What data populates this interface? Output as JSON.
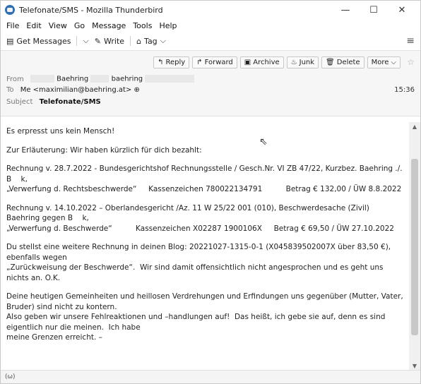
{
  "window": {
    "title": "Telefonate/SMS - Mozilla Thunderbird",
    "minimize": "—",
    "maximize": "☐",
    "close": "✕"
  },
  "menu": [
    "File",
    "Edit",
    "View",
    "Go",
    "Message",
    "Tools",
    "Help"
  ],
  "toolbar": {
    "get_messages": "Get Messages",
    "write": "Write",
    "tag": "Tag"
  },
  "actions": {
    "reply": "Reply",
    "forward": "Forward",
    "archive": "Archive",
    "junk": "Junk",
    "delete": "Delete",
    "more": "More"
  },
  "header": {
    "from_label": "From",
    "from_name": "Baehring",
    "from_email_part": "baehring",
    "to_label": "To",
    "to_value": "Me <maximilian@baehring.at>",
    "subject_label": "Subject",
    "subject": "Telefonate/SMS",
    "time": "15:36"
  },
  "body": [
    "Es erpresst uns kein Mensch!",
    "Zur Erläuterung: Wir haben kürzlich für dich bezahlt:",
    "Rechnung v. 28.7.2022 - Bundesgerichtshof Rechnungsstelle / Gesch.Nr. VI ZB 47/22, Kurzbez. Baehring ./. B    k,\n„Verwerfung d. Rechtsbeschwerde“     Kassenzeichen 780022134791          Betrag € 132,00 / ÜW 8.8.2022",
    "Rechnung v. 14.10.2022 – Oberlandesgericht /Az. 11 W 25/22 001 (010), Beschwerdesache (Zivil) Baehring gegen B    k,\n„Verwerfung d. Beschwerde“          Kassenzeichen X02287 1900106X     Betrag € 69,50 / ÜW 27.10.2022",
    "Du stellst eine weitere Rechnung in deinen Blog: 20221027-1315-0-1 (X045839502007X über 83,50 €), ebenfalls wegen\n„Zurückweisung der Beschwerde“.  Wir sind damit offensichtlich nicht angesprochen und es geht uns nichts an. O.K.",
    "Deine heutigen Gemeinheiten und heillosen Verdrehungen und Erfindungen uns gegenüber (Mutter, Vater, Bruder) sind nicht zu kontern.\nAlso geben wir unsere Fehlreaktionen und –handlungen auf!  Das heißt, ich gebe sie auf, denn es sind eigentlich nur die meinen.  Ich habe\nmeine Grenzen erreicht. –"
  ],
  "status": "(ω)",
  "icons": [
    "thunderbird-icon",
    "get-messages-icon",
    "write-icon",
    "tag-icon",
    "reply-icon",
    "forward-icon",
    "archive-icon",
    "junk-icon",
    "delete-icon",
    "star-icon",
    "hamburger-icon"
  ]
}
